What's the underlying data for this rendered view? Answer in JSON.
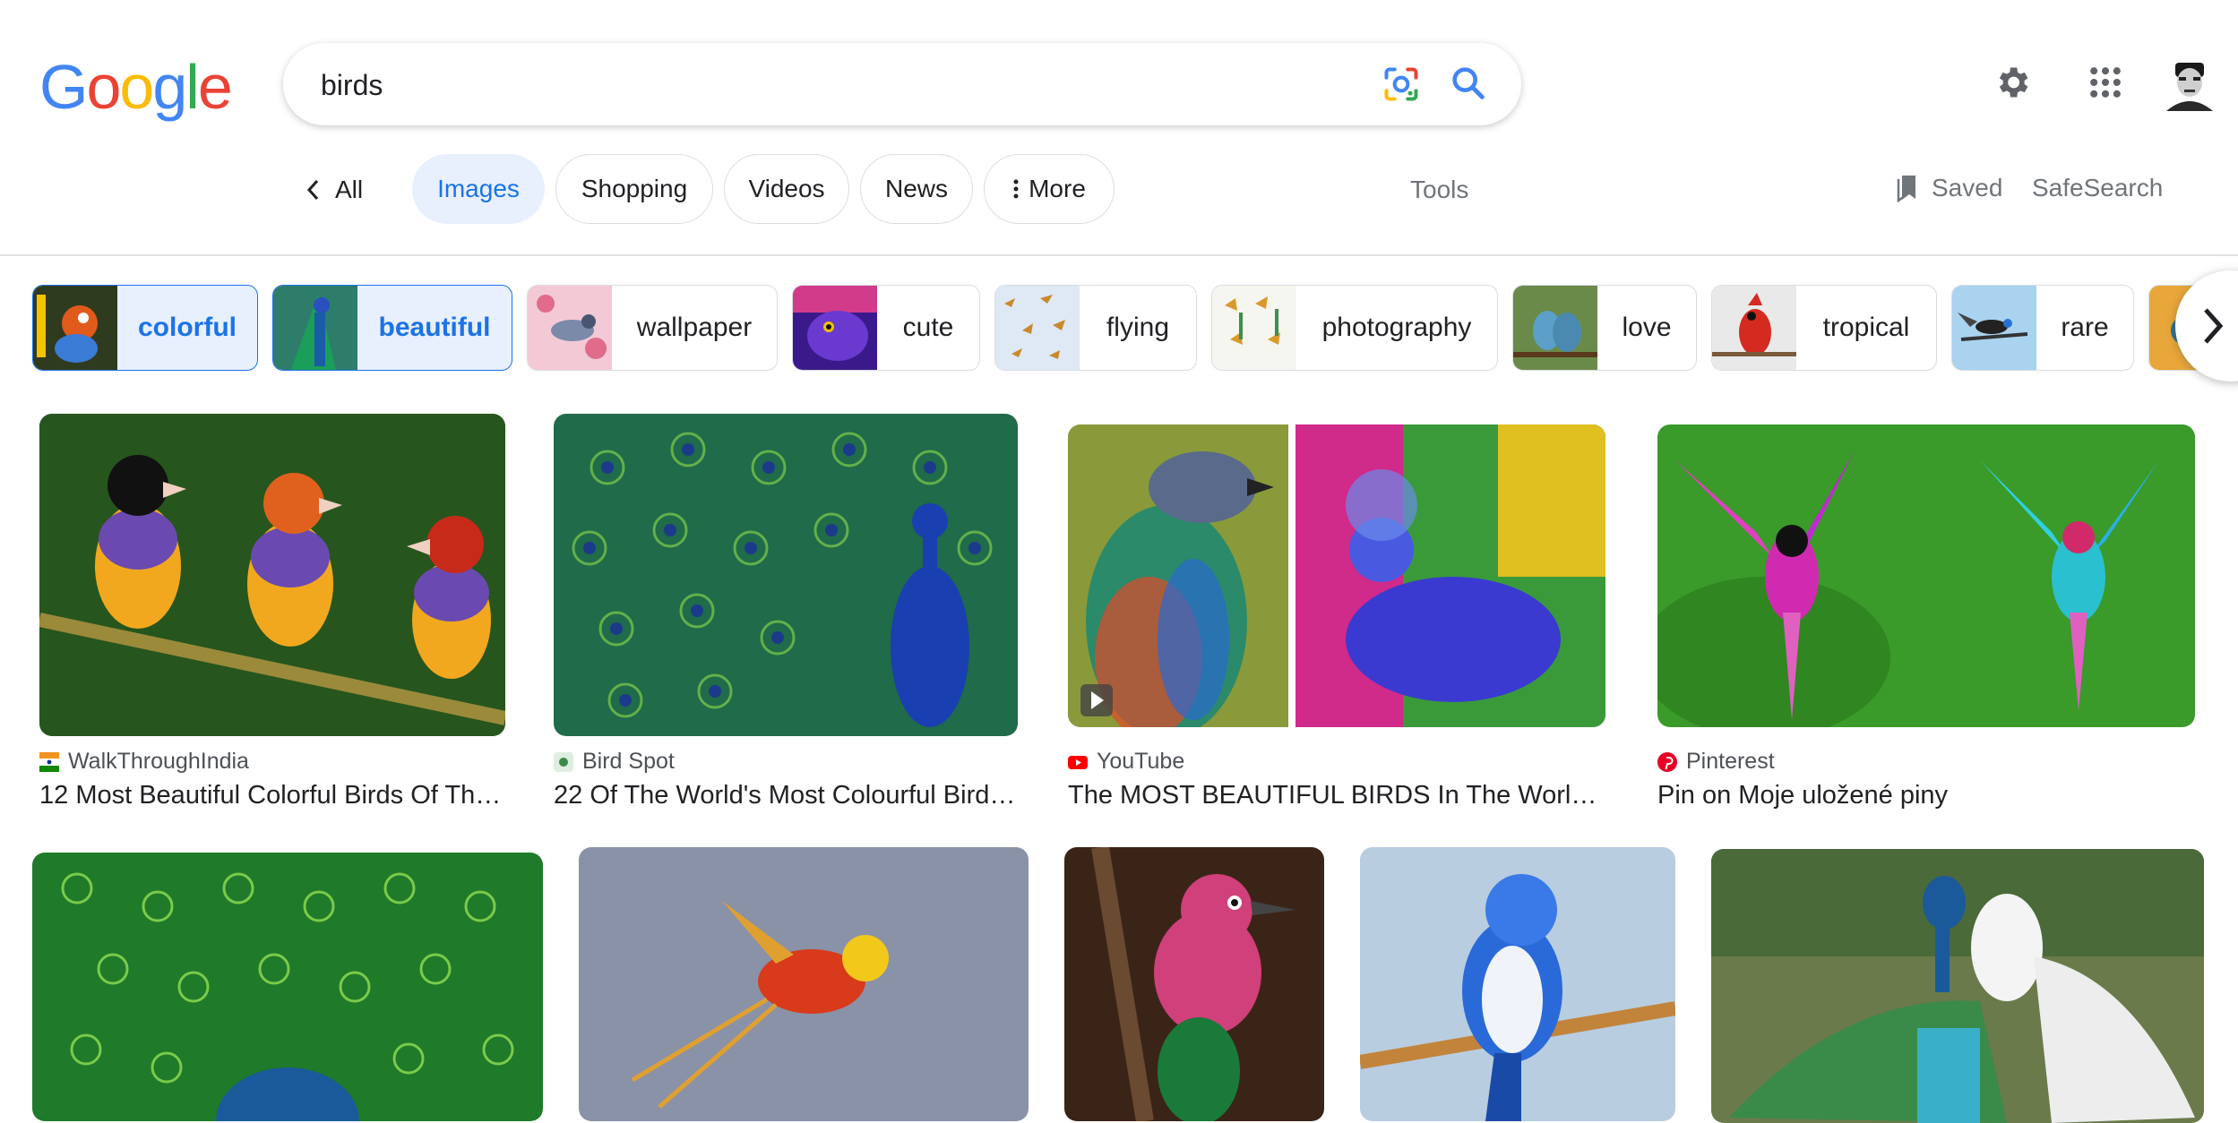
{
  "logo": {
    "letters": [
      "G",
      "o",
      "o",
      "g",
      "l",
      "e"
    ],
    "colors": [
      "#4285F4",
      "#EA4335",
      "#FBBC05",
      "#4285F4",
      "#34A853",
      "#EA4335"
    ]
  },
  "search": {
    "value": "birds"
  },
  "nav": {
    "back_label": "All",
    "tabs": [
      {
        "label": "Images",
        "active": true
      },
      {
        "label": "Shopping"
      },
      {
        "label": "Videos"
      },
      {
        "label": "News"
      },
      {
        "label": "More"
      }
    ],
    "tools": "Tools",
    "saved": "Saved",
    "safesearch": "SafeSearch"
  },
  "refinements": [
    {
      "label": "colorful",
      "selected": true
    },
    {
      "label": "beautiful",
      "selected": true
    },
    {
      "label": "wallpaper"
    },
    {
      "label": "cute"
    },
    {
      "label": "flying"
    },
    {
      "label": "photography"
    },
    {
      "label": "love"
    },
    {
      "label": "tropical"
    },
    {
      "label": "rare"
    }
  ],
  "results": [
    {
      "source": "WalkThroughIndia",
      "title": "12 Most Beautiful Colorful Birds Of The Worl..."
    },
    {
      "source": "Bird Spot",
      "title": "22 Of The World's Most Colourful Birds Wor..."
    },
    {
      "source": "YouTube",
      "title": "The MOST BEAUTIFUL BIRDS In The World ..."
    },
    {
      "source": "Pinterest",
      "title": "Pin on Moje uložené piny"
    }
  ],
  "colors": {
    "accent": "#1a73e8",
    "chip_selected_bg": "#e8f0fe",
    "muted_text": "#70757a"
  }
}
